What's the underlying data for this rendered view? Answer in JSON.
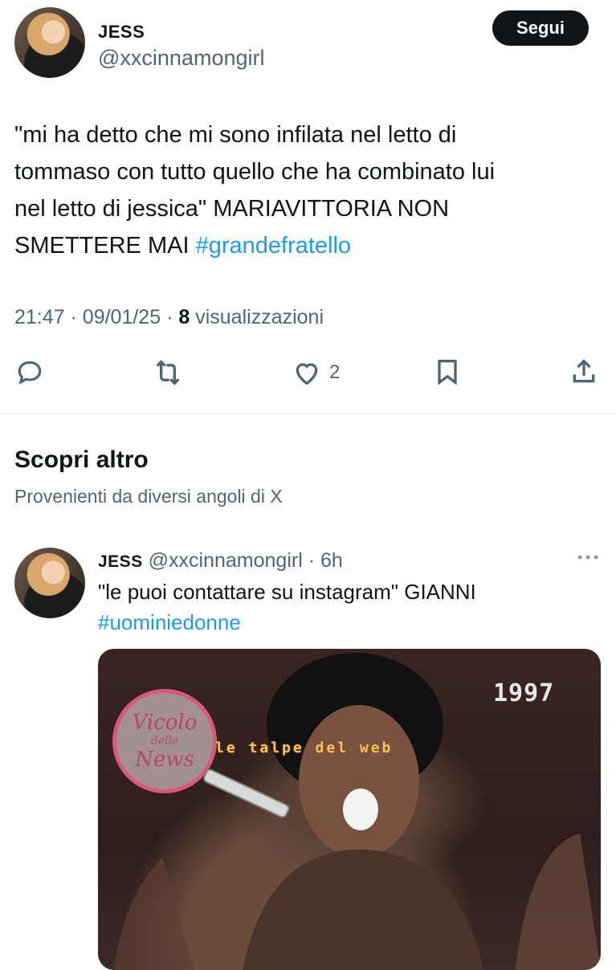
{
  "main_tweet": {
    "author_name": "JESS",
    "author_handle": "@xxcinnamongirl",
    "follow_label": "Segui",
    "text_lines": [
      "\"mi ha detto che mi sono infilata nel letto di",
      "tommaso con tutto quello che ha combinato lui",
      "nel letto di jessica\" MARIAVITTORIA NON"
    ],
    "text_last": "SMETTERE MAI",
    "hashtag": "#grandefratello",
    "time": "21:47",
    "date": "09/01/25",
    "views_count": "8",
    "views_label": "visualizzazioni",
    "likes": "2"
  },
  "discover": {
    "title": "Scopri altro",
    "subtitle": "Provenienti da diversi angoli di X"
  },
  "suggested_tweet": {
    "author_name": "JESS",
    "author_handle": "@xxcinnamongirl",
    "age": "6h",
    "text": "\"le puoi contattare su instagram\" GIANNI",
    "hashtag": "#uominiedonne",
    "media_label": "1997"
  },
  "watermarks": {
    "left_line1": "Vicolo",
    "left_line2": "delle",
    "left_line3": "News",
    "right": "le talpe del web"
  },
  "colors": {
    "accent": "#1d9bf0",
    "text": "#0f1419",
    "secondary": "#536471"
  },
  "icons": [
    "reply-icon",
    "retweet-icon",
    "like-icon",
    "bookmark-icon",
    "share-icon",
    "more-icon"
  ]
}
